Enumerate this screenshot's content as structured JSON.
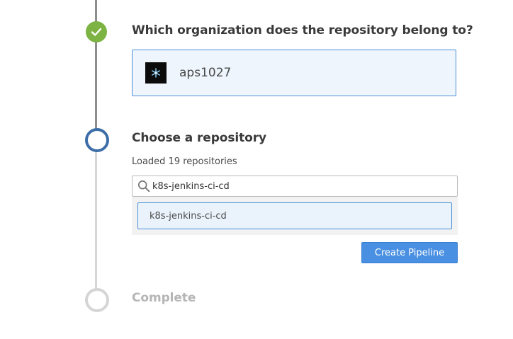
{
  "steps": {
    "organization": {
      "title": "Which organization does the repository belong to?",
      "status": "complete",
      "selected_org": {
        "name": "aps1027",
        "avatar_icon": "snowflake-avatar-icon"
      }
    },
    "repository": {
      "title": "Choose a repository",
      "status": "active",
      "loaded_text": "Loaded 19 repositories",
      "search": {
        "value": "k8s-jenkins-ci-cd",
        "icon": "search-icon"
      },
      "results": [
        {
          "label": "k8s-jenkins-ci-cd",
          "selected": true
        }
      ],
      "create_button_label": "Create Pipeline"
    },
    "complete": {
      "title": "Complete",
      "status": "pending"
    }
  },
  "colors": {
    "check_green": "#7cb342",
    "active_blue": "#3d6ea8",
    "accent_blue": "#4a90e2",
    "selected_bg": "#eef5fc",
    "pending_gray": "#d5d5d5"
  }
}
